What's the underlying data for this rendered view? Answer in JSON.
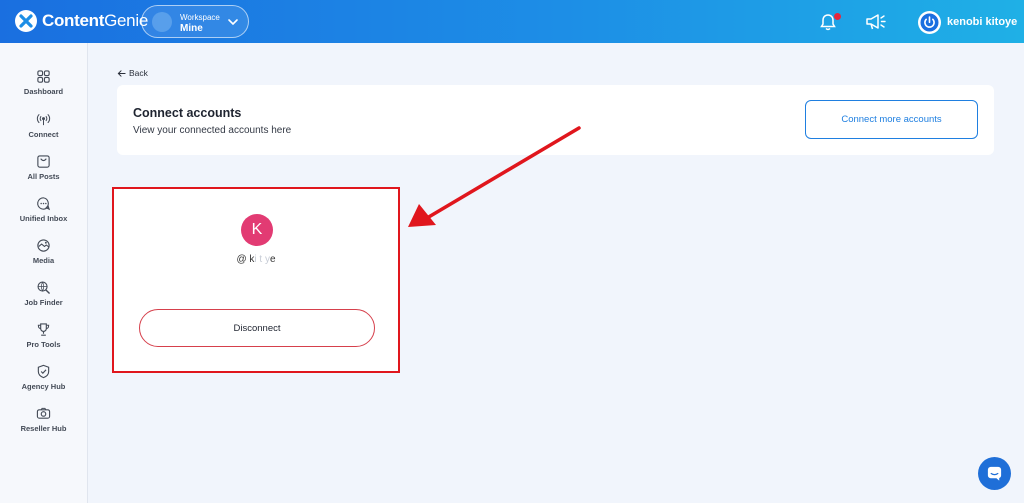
{
  "header": {
    "logo_bold": "Content",
    "logo_light": "Genie",
    "workspace_caption": "Workspace",
    "workspace_name": "Mine",
    "user_name": "kenobi kitoye",
    "notification_badge_color": "#e5263d"
  },
  "sidebar": {
    "items": [
      {
        "label": "Dashboard",
        "icon": "grid-icon"
      },
      {
        "label": "Connect",
        "icon": "broadcast-icon"
      },
      {
        "label": "All Posts",
        "icon": "inbox-tray-icon"
      },
      {
        "label": "Unified Inbox",
        "icon": "chat-bubble-icon"
      },
      {
        "label": "Media",
        "icon": "media-icon"
      },
      {
        "label": "Job Finder",
        "icon": "search-globe-icon"
      },
      {
        "label": "Pro Tools",
        "icon": "trophy-icon"
      },
      {
        "label": "Agency Hub",
        "icon": "shield-check-icon"
      },
      {
        "label": "Reseller Hub",
        "icon": "camera-icon"
      }
    ]
  },
  "main": {
    "back_label": "Back",
    "title": "Connect accounts",
    "subtitle": "View your connected accounts here",
    "connect_more_label": "Connect more accounts",
    "account": {
      "avatar_letter": "K",
      "avatar_color": "#e23b73",
      "handle_prefix": "@ k",
      "handle_masked": "i  t  y",
      "handle_suffix": "e",
      "disconnect_label": "Disconnect"
    }
  },
  "colors": {
    "accent": "#1f7fe0",
    "highlight_border": "#e0161d"
  }
}
